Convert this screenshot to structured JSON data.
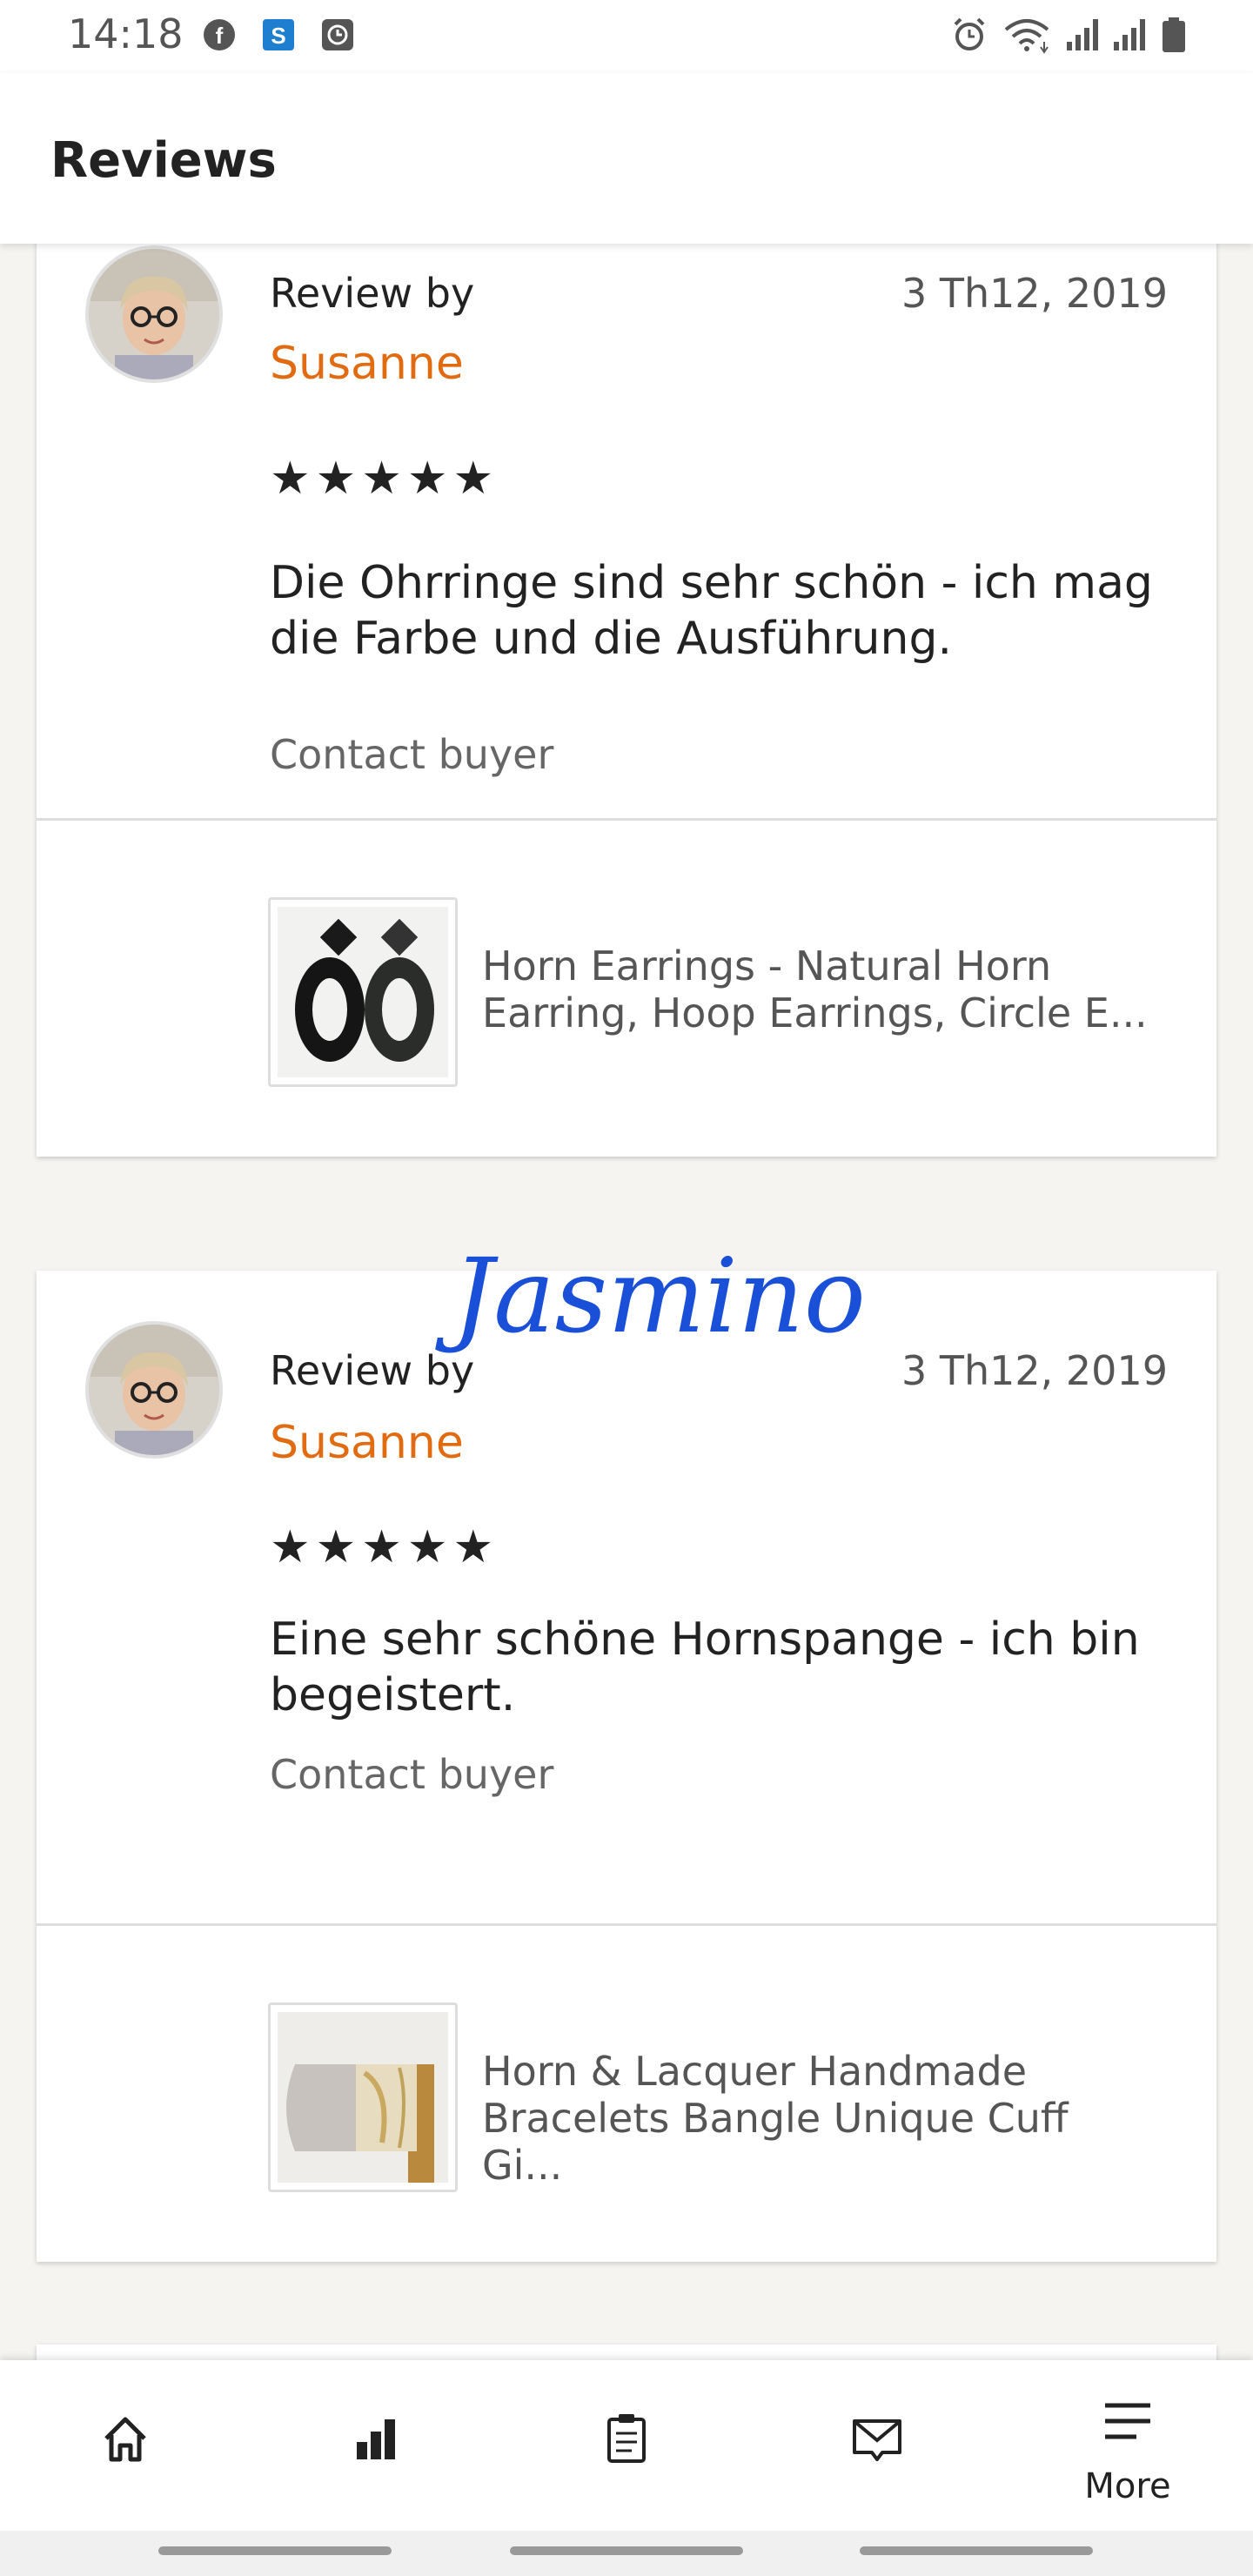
{
  "status_bar": {
    "time": "14:18",
    "left_icons": [
      "facebook-icon",
      "s-app-icon",
      "clock-app-icon"
    ],
    "right_icons": [
      "alarm-icon",
      "wifi-icon",
      "signal-icon",
      "signal-icon",
      "battery-icon"
    ]
  },
  "header": {
    "title": "Reviews"
  },
  "reviews": [
    {
      "review_by_label": "Review by",
      "reviewer": "Susanne",
      "date": "3 Th12, 2019",
      "stars": "★★★★★",
      "rating": 5,
      "text": "Die Ohrringe sind sehr schön - ich mag die Farbe und die Ausführung.",
      "contact_label": "Contact buyer",
      "listing_title": "Horn Earrings - Natural Horn Earring, Hoop Earrings, Circle E..."
    },
    {
      "review_by_label": "Review by",
      "reviewer": "Susanne",
      "date": "3 Th12, 2019",
      "stars": "★★★★★",
      "rating": 5,
      "text": "Eine sehr schöne Hornspange - ich bin begeistert.",
      "contact_label": "Contact buyer",
      "listing_title": "Horn & Lacquer Handmade Bracelets Bangle Unique Cuff Gi..."
    }
  ],
  "watermark": "Jasmino",
  "bottom_nav": {
    "items": [
      {
        "icon": "home-icon"
      },
      {
        "icon": "stats-icon"
      },
      {
        "icon": "orders-clipboard-icon"
      },
      {
        "icon": "messages-icon"
      },
      {
        "icon": "menu-icon",
        "label": "More"
      }
    ]
  },
  "colors": {
    "accent": "#e16b10",
    "watermark": "#1a4fd8",
    "background": "#f5f4f1"
  }
}
